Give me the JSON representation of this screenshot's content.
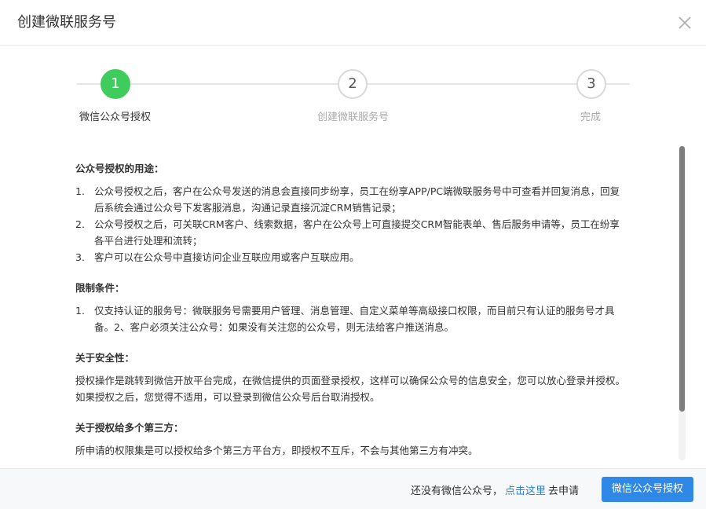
{
  "dialog": {
    "title": "创建微联服务号"
  },
  "steps": [
    {
      "number": "1",
      "label": "微信公众号授权",
      "active": true
    },
    {
      "number": "2",
      "label": "创建微联服务号",
      "active": false
    },
    {
      "number": "3",
      "label": "完成",
      "active": false
    }
  ],
  "content": {
    "usage": {
      "title": "公众号授权的用途：",
      "items": [
        {
          "num": "1.",
          "text": "公众号授权之后，客户在公众号发送的消息会直接同步纷享，员工在纷享APP/PC端微联服务号中可查看并回复消息，回复后系统会通过公众号下发客服消息，沟通记录直接沉淀CRM销售记录；"
        },
        {
          "num": "2.",
          "text": "公众号授权之后，可关联CRM客户、线索数据，客户在公众号上可直接提交CRM智能表单、售后服务申请等，员工在纷享各平台进行处理和流转；"
        },
        {
          "num": "3.",
          "text": "客户可以在公众号中直接访问企业互联应用或客户互联应用。"
        }
      ]
    },
    "restrictions": {
      "title": "限制条件：",
      "items": [
        {
          "num": "1.",
          "text": "仅支持认证的服务号：微联服务号需要用户管理、消息管理、自定义菜单等高级接口权限，而目前只有认证的服务号才具备。2、客户必须关注公众号：如果没有关注您的公众号，则无法给客户推送消息。"
        }
      ]
    },
    "security": {
      "title": "关于安全性：",
      "text": "授权操作是跳转到微信开放平台完成，在微信提供的页面登录授权，这样可以确保公众号的信息安全，您可以放心登录并授权。如果授权之后，您觉得不适用，可以登录到微信公众号后台取消授权。"
    },
    "third_party": {
      "title": "关于授权给多个第三方：",
      "text": "所申请的权限集是可以授权给多个第三方平台方，即授权不互斥，不会与其他第三方有冲突。"
    }
  },
  "footer": {
    "hint_prefix": "还没有微信公众号，",
    "hint_link": "点击这里",
    "hint_suffix": "去申请",
    "authorize_button": "微信公众号授权"
  },
  "colors": {
    "accent_green": "#3fcc5c",
    "primary_blue": "#2f87e6",
    "link_blue": "#2f7fd8"
  }
}
